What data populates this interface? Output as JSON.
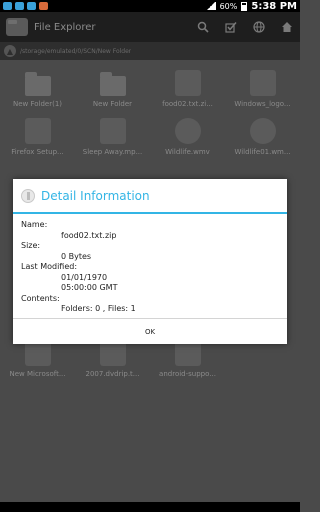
{
  "status": {
    "battery": "60%",
    "time": "5:38 PM"
  },
  "app": {
    "title": "File Explorer",
    "path": "/storage/emulated/0/SCN/New Folder"
  },
  "grid": [
    {
      "label": "New Folder(1)",
      "icon": "folder-icon"
    },
    {
      "label": "New Folder",
      "icon": "folder-icon"
    },
    {
      "label": "food02.txt.zi...",
      "icon": "zip-file-icon"
    },
    {
      "label": "Windows_logo...",
      "icon": "image-file-icon"
    },
    {
      "label": "Firefox Setup...",
      "icon": "installer-file-icon"
    },
    {
      "label": "Sleep Away.mp...",
      "icon": "music-file-icon"
    },
    {
      "label": "Wildlife.wmv",
      "icon": "video-file-icon"
    },
    {
      "label": "Wildlife01.wm...",
      "icon": "video-file-icon"
    },
    {
      "label": "New Microsoft...",
      "icon": "document-file-icon"
    },
    {
      "label": "2007.dvdrip.t...",
      "icon": "torrent-file-icon"
    },
    {
      "label": "android-suppo...",
      "icon": "tools-file-icon"
    }
  ],
  "dialog": {
    "title": "Detail Information",
    "name_label": "Name:",
    "name_value": "food02.txt.zip",
    "size_label": "Size:",
    "size_value": "0 Bytes",
    "modified_label": "Last Modified:",
    "modified_date": "01/01/1970",
    "modified_time": "05:00:00 GMT",
    "contents_label": "Contents:",
    "contents_value": "Folders: 0 ,    Files: 1",
    "ok_label": "OK"
  },
  "colors": {
    "accent": "#33b5e5"
  }
}
